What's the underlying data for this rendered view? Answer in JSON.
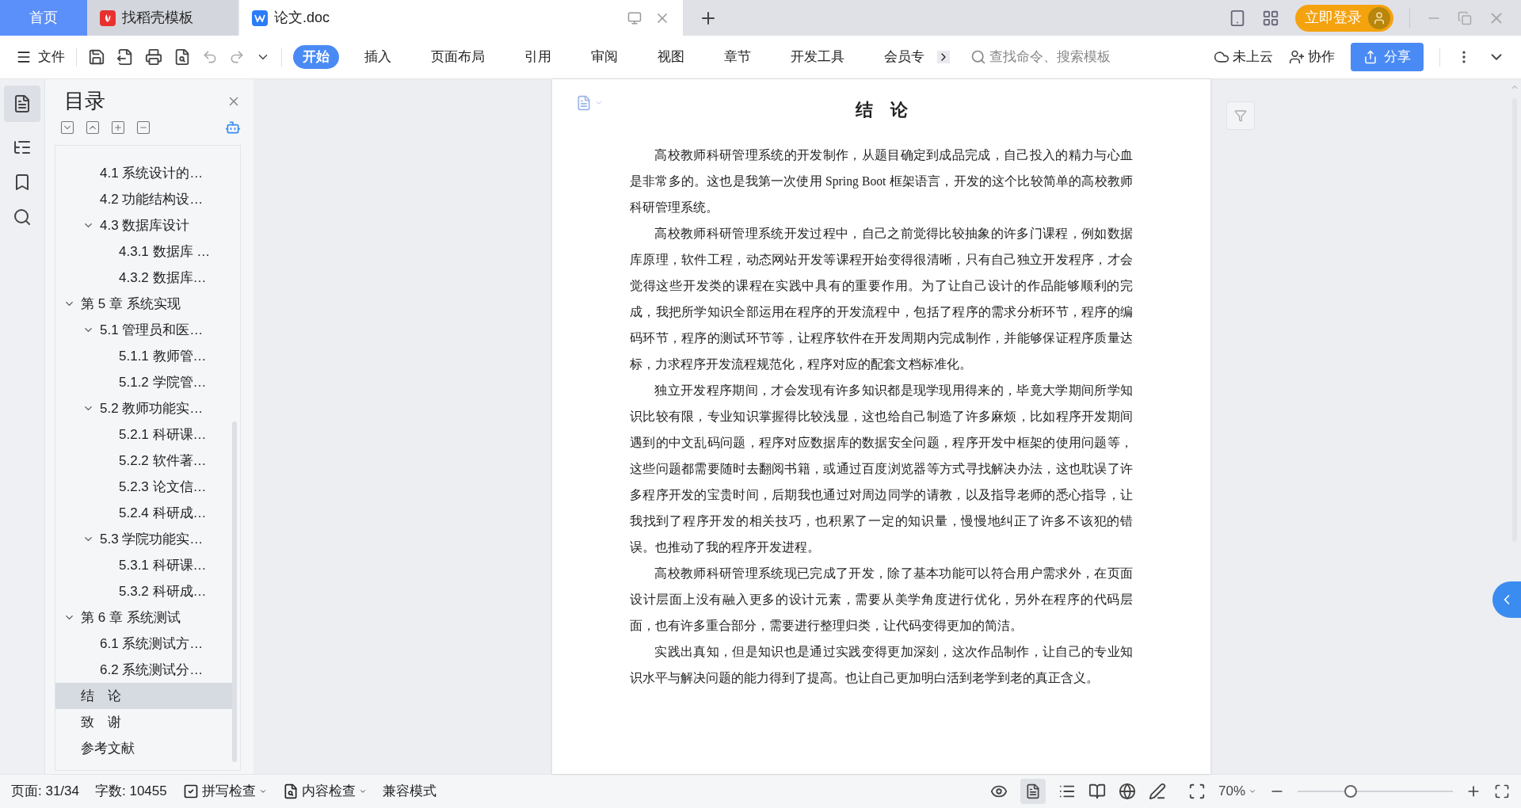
{
  "tabs": [
    {
      "label": "首页",
      "kind": "home",
      "selected": false
    },
    {
      "label": "找稻壳模板",
      "kind": "docer",
      "selected": false
    },
    {
      "label": "论文.doc",
      "kind": "doc",
      "selected": true
    }
  ],
  "title_bar": {
    "login": "立即登录"
  },
  "toolbar": {
    "file_menu": "文件",
    "ribbon_tabs": [
      {
        "label": "开始",
        "selected": true
      },
      {
        "label": "插入",
        "selected": false
      },
      {
        "label": "页面布局",
        "selected": false
      },
      {
        "label": "引用",
        "selected": false
      },
      {
        "label": "审阅",
        "selected": false
      },
      {
        "label": "视图",
        "selected": false
      },
      {
        "label": "章节",
        "selected": false
      },
      {
        "label": "开发工具",
        "selected": false
      },
      {
        "label": "会员专",
        "selected": false
      }
    ],
    "search": {
      "placeholder": "查找命令、搜索模板"
    },
    "cloud": "未上云",
    "collaborate": "协作",
    "share": "分享"
  },
  "outline": {
    "title": "目录",
    "items": [
      {
        "children": [
          {
            "label": "4.1 系统设计的…"
          },
          {
            "label": "4.2 功能结构设…"
          },
          {
            "label": "4.3 数据库设计",
            "expanded": true,
            "children": [
              {
                "label": "4.3.1 数据库 …"
              },
              {
                "label": "4.3.2 数据库…"
              }
            ]
          }
        ]
      },
      {
        "label": "第 5 章 系统实现",
        "expanded": true,
        "children": [
          {
            "label": "5.1 管理员和医…",
            "expanded": true,
            "children": [
              {
                "label": "5.1.1 教师管…"
              },
              {
                "label": "5.1.2 学院管…"
              }
            ]
          },
          {
            "label": "5.2 教师功能实…",
            "expanded": true,
            "children": [
              {
                "label": "5.2.1 科研课…"
              },
              {
                "label": "5.2.2 软件著…"
              },
              {
                "label": "5.2.3 论文信…"
              },
              {
                "label": "5.2.4 科研成…"
              }
            ]
          },
          {
            "label": "5.3 学院功能实…",
            "expanded": true,
            "children": [
              {
                "label": "5.3.1 科研课…"
              },
              {
                "label": "5.3.2 科研成…"
              }
            ]
          }
        ]
      },
      {
        "label": "第 6 章 系统测试",
        "expanded": true,
        "children": [
          {
            "label": "6.1 系统测试方…"
          },
          {
            "label": "6.2 系统测试分…"
          }
        ]
      },
      {
        "label": "结　论",
        "selected": true
      },
      {
        "label": "致　谢",
        "selected": false
      },
      {
        "label": "参考文献",
        "selected": false
      }
    ]
  },
  "document": {
    "title": "结　论",
    "paragraphs": [
      "高校教师科研管理系统的开发制作，从题目确定到成品完成，自己投入的精力与心血是非常多的。这也是我第一次使用 Spring Boot 框架语言，开发的这个比较简单的高校教师科研管理系统。",
      "高校教师科研管理系统开发过程中，自己之前觉得比较抽象的许多门课程，例如数据库原理，软件工程，动态网站开发等课程开始变得很清晰，只有自己独立开发程序，才会觉得这些开发类的课程在实践中具有的重要作用。为了让自己设计的作品能够顺利的完成，我把所学知识全部运用在程序的开发流程中，包括了程序的需求分析环节，程序的编码环节，程序的测试环节等，让程序软件在开发周期内完成制作，并能够保证程序质量达标，力求程序开发流程规范化，程序对应的配套文档标准化。",
      "独立开发程序期间，才会发现有许多知识都是现学现用得来的，毕竟大学期间所学知识比较有限，专业知识掌握得比较浅显，这也给自己制造了许多麻烦，比如程序开发期间遇到的中文乱码问题，程序对应数据库的数据安全问题，程序开发中框架的使用问题等，这些问题都需要随时去翻阅书籍，或通过百度浏览器等方式寻找解决办法，这也耽误了许多程序开发的宝贵时间，后期我也通过对周边同学的请教，以及指导老师的悉心指导，让我找到了程序开发的相关技巧，也积累了一定的知识量，慢慢地纠正了许多不该犯的错误。也推动了我的程序开发进程。",
      "高校教师科研管理系统现已完成了开发，除了基本功能可以符合用户需求外，在页面设计层面上没有融入更多的设计元素，需要从美学角度进行优化，另外在程序的代码层面，也有许多重合部分，需要进行整理归类，让代码变得更加的简洁。",
      "实践出真知，但是知识也是通过实践变得更加深刻，这次作品制作，让自己的专业知识水平与解决问题的能力得到了提高。也让自己更加明白活到老学到老的真正含义。"
    ]
  },
  "status_bar": {
    "page": "页面: 31/34",
    "words": "字数: 10455",
    "spell_check": "拼写检查",
    "content_check": "内容检查",
    "compat_mode": "兼容模式",
    "zoom": "70%",
    "zoom_slider": {
      "level": 0.34
    }
  }
}
